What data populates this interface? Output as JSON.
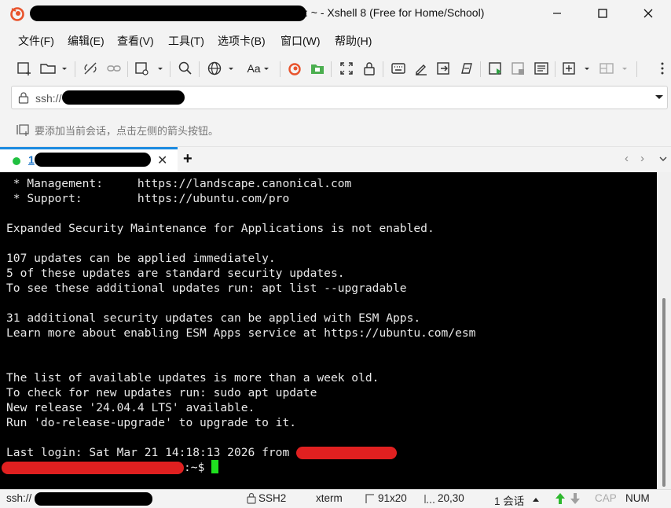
{
  "window": {
    "title": ": ~ - Xshell 8 (Free for Home/School)"
  },
  "menu": [
    "文件(F)",
    "编辑(E)",
    "查看(V)",
    "工具(T)",
    "选项卡(B)",
    "窗口(W)",
    "帮助(H)"
  ],
  "toolbar": {
    "font_label": "Aa"
  },
  "address": {
    "prefix": "ssh://"
  },
  "hint": {
    "text": "要添加当前会话，点击左侧的箭头按钮。"
  },
  "tab": {
    "number": "1"
  },
  "terminal": {
    "lines": [
      " * Management:     https://landscape.canonical.com",
      " * Support:        https://ubuntu.com/pro",
      "",
      "Expanded Security Maintenance for Applications is not enabled.",
      "",
      "107 updates can be applied immediately.",
      "5 of these updates are standard security updates.",
      "To see these additional updates run: apt list --upgradable",
      "",
      "31 additional security updates can be applied with ESM Apps.",
      "Learn more about enabling ESM Apps service at https://ubuntu.com/esm",
      "",
      "",
      "The list of available updates is more than a week old.",
      "To check for new updates run: sudo apt update",
      "New release '24.04.4 LTS' available.",
      "Run 'do-release-upgrade' to upgrade to it.",
      ""
    ],
    "last_login": "Last login: Sat Mar 21 14:18:13 2026 from ",
    "prompt_suffix": ":~$ "
  },
  "status": {
    "connection": "ssh://",
    "protocol": "SSH2",
    "terminal_type": "xterm",
    "size": "91x20",
    "cursor": "20,30",
    "sessions": "1 会话",
    "cap": "CAP",
    "num": "NUM"
  },
  "colors": {
    "accent": "#1a8ae0",
    "terminal_bg": "#000000",
    "terminal_fg": "#e8e8e8",
    "cursor": "#20e020",
    "redaction_red": "#e02020"
  }
}
